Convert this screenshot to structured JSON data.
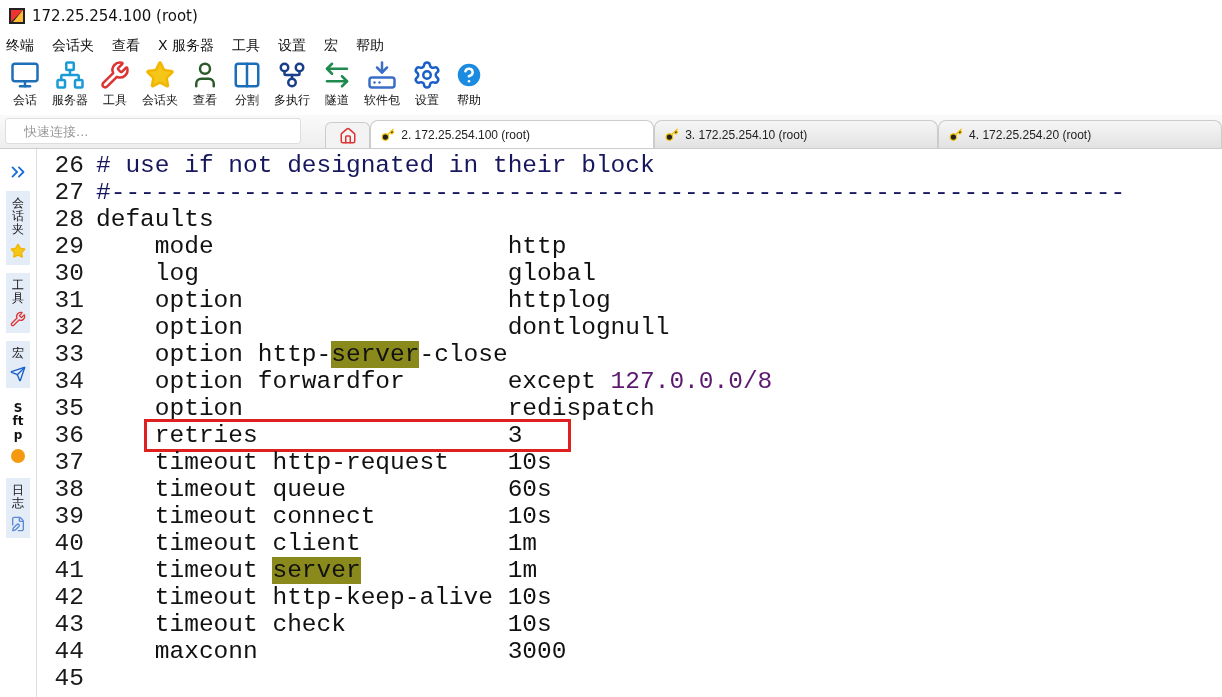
{
  "window": {
    "title": "172.25.254.100 (root)"
  },
  "menu": [
    "终端",
    "会话夹",
    "查看",
    "X 服务器",
    "工具",
    "设置",
    "宏",
    "帮助"
  ],
  "toolbar": [
    "会话",
    "服务器",
    "工具",
    "会话夹",
    "查看",
    "分割",
    "多执行",
    "隧道",
    "软件包",
    "设置",
    "帮助"
  ],
  "quick_connect": {
    "placeholder": "快速连接..."
  },
  "tabs": [
    {
      "label": "2. 172.25.254.100 (root)",
      "selected": true
    },
    {
      "label": "3. 172.25.254.10 (root)",
      "selected": false
    },
    {
      "label": "4. 172.25.254.20 (root)",
      "selected": false
    }
  ],
  "sidebar": [
    {
      "label": "会话夹",
      "selected": false
    },
    {
      "label": "工具",
      "selected": false
    },
    {
      "label": "宏",
      "selected": false
    },
    {
      "label": "Sftp",
      "selected": true
    },
    {
      "label": "日志",
      "selected": false
    }
  ],
  "editor": {
    "lines": [
      {
        "number": "26",
        "segments": [
          {
            "kind": "comment",
            "text": "# use if not designated in their block"
          }
        ]
      },
      {
        "number": "27",
        "segments": [
          {
            "kind": "comment",
            "text": "#---------------------------------------------------------------------"
          }
        ]
      },
      {
        "number": "28",
        "segments": [
          {
            "kind": "plain",
            "text": "defaults"
          }
        ]
      },
      {
        "number": "29",
        "segments": [
          {
            "kind": "plain",
            "text": "    mode                    http"
          }
        ]
      },
      {
        "number": "30",
        "segments": [
          {
            "kind": "plain",
            "text": "    log                     global"
          }
        ]
      },
      {
        "number": "31",
        "segments": [
          {
            "kind": "plain",
            "text": "    option                  httplog"
          }
        ]
      },
      {
        "number": "32",
        "segments": [
          {
            "kind": "plain",
            "text": "    option                  dontlognull"
          }
        ]
      },
      {
        "number": "33",
        "segments": [
          {
            "kind": "plain",
            "text": "    option http-"
          },
          {
            "kind": "match",
            "text": "server"
          },
          {
            "kind": "plain",
            "text": "-close"
          }
        ]
      },
      {
        "number": "34",
        "segments": [
          {
            "kind": "plain",
            "text": "    option forwardfor       except "
          },
          {
            "kind": "number",
            "text": "127.0.0.0/8"
          }
        ]
      },
      {
        "number": "35",
        "segments": [
          {
            "kind": "plain",
            "text": "    option                  redispatch"
          }
        ]
      },
      {
        "number": "36",
        "segments": [
          {
            "kind": "boxed",
            "text": "retries                 3"
          }
        ]
      },
      {
        "number": "37",
        "segments": [
          {
            "kind": "plain",
            "text": "    timeout http-request    10s"
          }
        ]
      },
      {
        "number": "38",
        "segments": [
          {
            "kind": "plain",
            "text": "    timeout queue           60s"
          }
        ]
      },
      {
        "number": "39",
        "segments": [
          {
            "kind": "plain",
            "text": "    timeout connect         10s"
          }
        ]
      },
      {
        "number": "40",
        "segments": [
          {
            "kind": "plain",
            "text": "    timeout client          1m"
          }
        ]
      },
      {
        "number": "41",
        "segments": [
          {
            "kind": "plain",
            "text": "    timeout "
          },
          {
            "kind": "match",
            "text": "server"
          },
          {
            "kind": "plain",
            "text": "          1m"
          }
        ]
      },
      {
        "number": "42",
        "segments": [
          {
            "kind": "plain",
            "text": "    timeout http-keep-alive 10s"
          }
        ]
      },
      {
        "number": "43",
        "segments": [
          {
            "kind": "plain",
            "text": "    timeout check           10s"
          }
        ]
      },
      {
        "number": "44",
        "segments": [
          {
            "kind": "plain",
            "text": "    maxconn                 3000"
          }
        ]
      },
      {
        "number": "45"
      }
    ]
  }
}
